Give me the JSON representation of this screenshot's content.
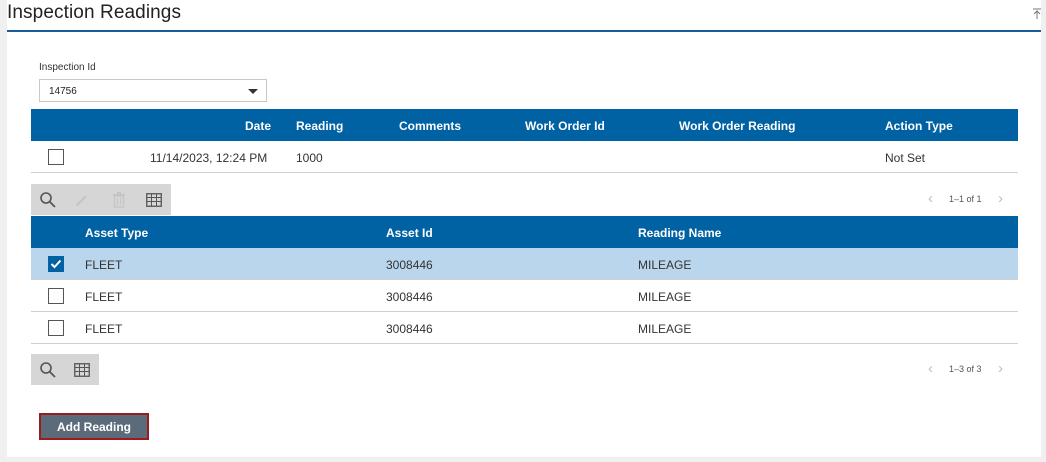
{
  "page": {
    "title": "Inspection Readings"
  },
  "inspection_field": {
    "label": "Inspection Id",
    "value": "14756"
  },
  "readings_table": {
    "columns": [
      "Date",
      "Reading",
      "Comments",
      "Work Order Id",
      "Work Order Reading",
      "Action Type"
    ],
    "rows": [
      {
        "date": "11/14/2023, 12:24 PM",
        "reading": "1000",
        "comments": "",
        "work_order_id": "",
        "work_order_reading": "",
        "action_type": "Not Set",
        "checked": false
      }
    ],
    "pager": "1–1 of 1"
  },
  "assets_table": {
    "columns": [
      "Asset Type",
      "Asset Id",
      "Reading Name"
    ],
    "rows": [
      {
        "asset_type": "FLEET",
        "asset_id": "3008446",
        "reading_name": "MILEAGE",
        "checked": true
      },
      {
        "asset_type": "FLEET",
        "asset_id": "3008446",
        "reading_name": "MILEAGE",
        "checked": false
      },
      {
        "asset_type": "FLEET",
        "asset_id": "3008446",
        "reading_name": "MILEAGE",
        "checked": false
      }
    ],
    "pager": "1–3 of 3"
  },
  "toolbar_icons": {
    "search": "search-icon",
    "edit": "pencil-icon",
    "delete": "trash-icon",
    "columns": "table-columns-icon"
  },
  "add_button": {
    "label": "Add Reading"
  },
  "colors": {
    "header_blue": "#0061a3",
    "selected_row": "#b9d6ed",
    "title_rule": "#1a5d9a",
    "button_bg": "#5c6b7a",
    "button_border": "#9b1c1c"
  }
}
